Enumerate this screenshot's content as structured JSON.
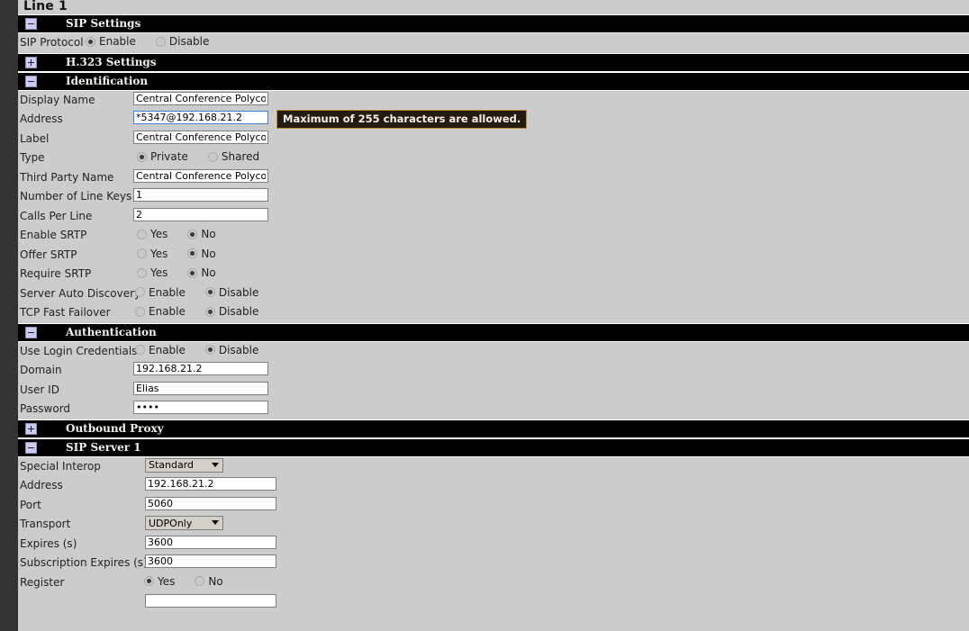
{
  "page": {
    "title": "Line 1"
  },
  "icons": {
    "collapse": "minus-icon",
    "expand": "plus-icon",
    "dropdown": "chevron-down-icon"
  },
  "tooltip": {
    "text": "Maximum of 255 characters are allowed."
  },
  "sections": [
    {
      "id": "sip-settings",
      "title": "SIP Settings",
      "state": "expanded",
      "rows": [
        {
          "type": "radio",
          "label": "SIP Protocol",
          "options": [
            "Enable",
            "Disable"
          ],
          "selected": "Enable"
        }
      ]
    },
    {
      "id": "h323-settings",
      "title": "H.323 Settings",
      "state": "collapsed",
      "rows": []
    },
    {
      "id": "identification",
      "title": "Identification",
      "state": "expanded",
      "rows": [
        {
          "type": "text",
          "label": "Display Name",
          "value": "Central Conference Polycom"
        },
        {
          "type": "text",
          "label": "Address",
          "value": "*5347@192.168.21.2",
          "focused": true,
          "tooltip": true
        },
        {
          "type": "text",
          "label": "Label",
          "value": "Central Conference Polycom"
        },
        {
          "type": "radio",
          "label": "Type",
          "options": [
            "Private",
            "Shared"
          ],
          "selected": "Private"
        },
        {
          "type": "text",
          "label": "Third Party Name",
          "value": "Central Conference Polycom"
        },
        {
          "type": "text",
          "label": "Number of Line Keys",
          "value": "1"
        },
        {
          "type": "text",
          "label": "Calls Per Line",
          "value": "2"
        },
        {
          "type": "radio",
          "label": "Enable SRTP",
          "options": [
            "Yes",
            "No"
          ],
          "selected": "No"
        },
        {
          "type": "radio",
          "label": "Offer SRTP",
          "options": [
            "Yes",
            "No"
          ],
          "selected": "No"
        },
        {
          "type": "radio",
          "label": "Require SRTP",
          "options": [
            "Yes",
            "No"
          ],
          "selected": "No"
        },
        {
          "type": "radio",
          "label": "Server Auto Discovery",
          "options": [
            "Enable",
            "Disable"
          ],
          "selected": "Disable"
        },
        {
          "type": "radio",
          "label": "TCP Fast Failover",
          "options": [
            "Enable",
            "Disable"
          ],
          "selected": "Disable"
        }
      ]
    },
    {
      "id": "authentication",
      "title": "Authentication",
      "state": "expanded",
      "rows": [
        {
          "type": "radio",
          "label": "Use Login Credentials",
          "options": [
            "Enable",
            "Disable"
          ],
          "selected": "Disable"
        },
        {
          "type": "text",
          "label": "Domain",
          "value": "192.168.21.2"
        },
        {
          "type": "text",
          "label": "User ID",
          "value": "Elias"
        },
        {
          "type": "password",
          "label": "Password",
          "value": "••••"
        }
      ]
    },
    {
      "id": "outbound-proxy",
      "title": "Outbound Proxy",
      "state": "collapsed",
      "rows": []
    },
    {
      "id": "sip-server-1",
      "title": "SIP Server 1",
      "state": "expanded",
      "rows": [
        {
          "type": "select",
          "label": "Special Interop",
          "value": "Standard"
        },
        {
          "type": "text",
          "label": "Address",
          "value": "192.168.21.2"
        },
        {
          "type": "text",
          "label": "Port",
          "value": "5060"
        },
        {
          "type": "select",
          "label": "Transport",
          "value": "UDPOnly"
        },
        {
          "type": "text",
          "label": "Expires (s)",
          "value": "3600"
        },
        {
          "type": "text",
          "label": "Subscription Expires (s)",
          "value": "3600"
        },
        {
          "type": "radio",
          "label": "Register",
          "options": [
            "Yes",
            "No"
          ],
          "selected": "Yes"
        },
        {
          "type": "text",
          "label": "",
          "value": "",
          "clipped": true
        }
      ]
    }
  ]
}
